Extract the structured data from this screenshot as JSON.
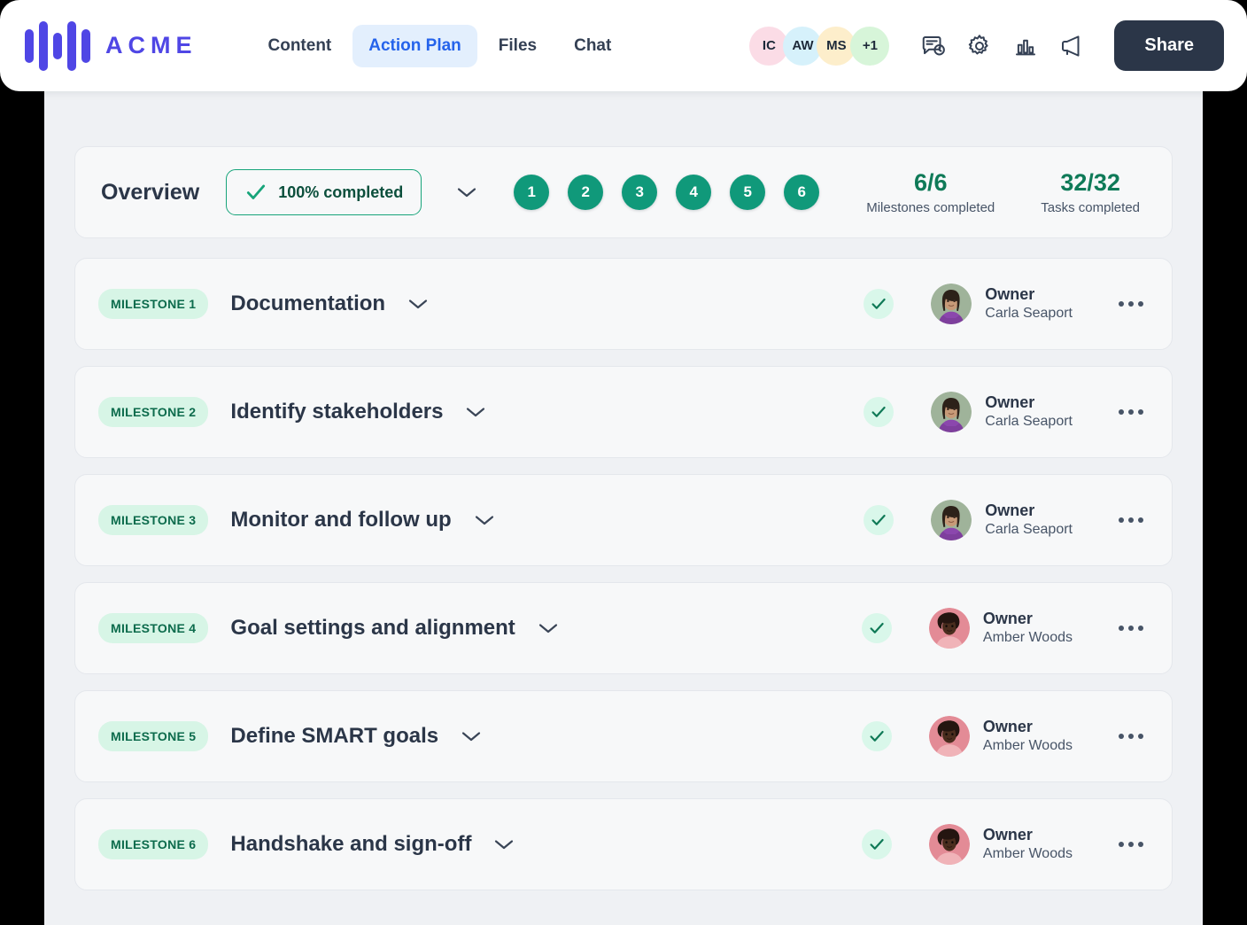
{
  "brand": {
    "name": "ACME",
    "logo_icon": "waveform-bars-logo",
    "color": "#4f46e5"
  },
  "nav": {
    "items": [
      {
        "label": "Content",
        "active": false
      },
      {
        "label": "Action Plan",
        "active": true
      },
      {
        "label": "Files",
        "active": false
      },
      {
        "label": "Chat",
        "active": false
      }
    ]
  },
  "header": {
    "avatars": [
      {
        "initials": "IC",
        "color": "#fbdce6"
      },
      {
        "initials": "AW",
        "color": "#d6f1fb"
      },
      {
        "initials": "MS",
        "color": "#fdeecb"
      },
      {
        "initials": "+1",
        "color": "#d7f5d9"
      }
    ],
    "icons": [
      {
        "name": "message-clock-icon"
      },
      {
        "name": "gear-icon"
      },
      {
        "name": "bar-chart-icon"
      },
      {
        "name": "megaphone-icon"
      }
    ],
    "share_label": "Share",
    "share_color": "#2b3648"
  },
  "overview": {
    "title": "Overview",
    "completion_label": "100% completed",
    "check_icon": "check-icon",
    "chevron_icon": "chevron-down-icon",
    "steps": [
      "1",
      "2",
      "3",
      "4",
      "5",
      "6"
    ],
    "step_color": "#10997a",
    "stats": [
      {
        "value": "6/6",
        "label": "Milestones completed"
      },
      {
        "value": "32/32",
        "label": "Tasks completed"
      }
    ],
    "stat_color": "#0f7a58"
  },
  "milestones": [
    {
      "badge": "MILESTONE 1",
      "title": "Documentation",
      "chevron_icon": "chevron-down-icon",
      "status_icon": "check-circle-icon",
      "owner_role": "Owner",
      "owner_name": "Carla Seaport",
      "avatar": "carla",
      "menu_icon": "more-options-icon"
    },
    {
      "badge": "MILESTONE 2",
      "title": "Identify stakeholders",
      "chevron_icon": "chevron-down-icon",
      "status_icon": "check-circle-icon",
      "owner_role": "Owner",
      "owner_name": "Carla Seaport",
      "avatar": "carla",
      "menu_icon": "more-options-icon"
    },
    {
      "badge": "MILESTONE 3",
      "title": "Monitor and follow up",
      "chevron_icon": "chevron-down-icon",
      "status_icon": "check-circle-icon",
      "owner_role": "Owner",
      "owner_name": "Carla Seaport",
      "avatar": "carla",
      "menu_icon": "more-options-icon"
    },
    {
      "badge": "MILESTONE 4",
      "title": "Goal settings and alignment",
      "chevron_icon": "chevron-down-icon",
      "status_icon": "check-circle-icon",
      "owner_role": "Owner",
      "owner_name": "Amber Woods",
      "avatar": "amber",
      "menu_icon": "more-options-icon"
    },
    {
      "badge": "MILESTONE 5",
      "title": "Define SMART goals",
      "chevron_icon": "chevron-down-icon",
      "status_icon": "check-circle-icon",
      "owner_role": "Owner",
      "owner_name": "Amber Woods",
      "avatar": "amber",
      "menu_icon": "more-options-icon"
    },
    {
      "badge": "MILESTONE 6",
      "title": "Handshake and sign-off",
      "chevron_icon": "chevron-down-icon",
      "status_icon": "check-circle-icon",
      "owner_role": "Owner",
      "owner_name": "Amber Woods",
      "avatar": "amber",
      "menu_icon": "more-options-icon"
    }
  ]
}
